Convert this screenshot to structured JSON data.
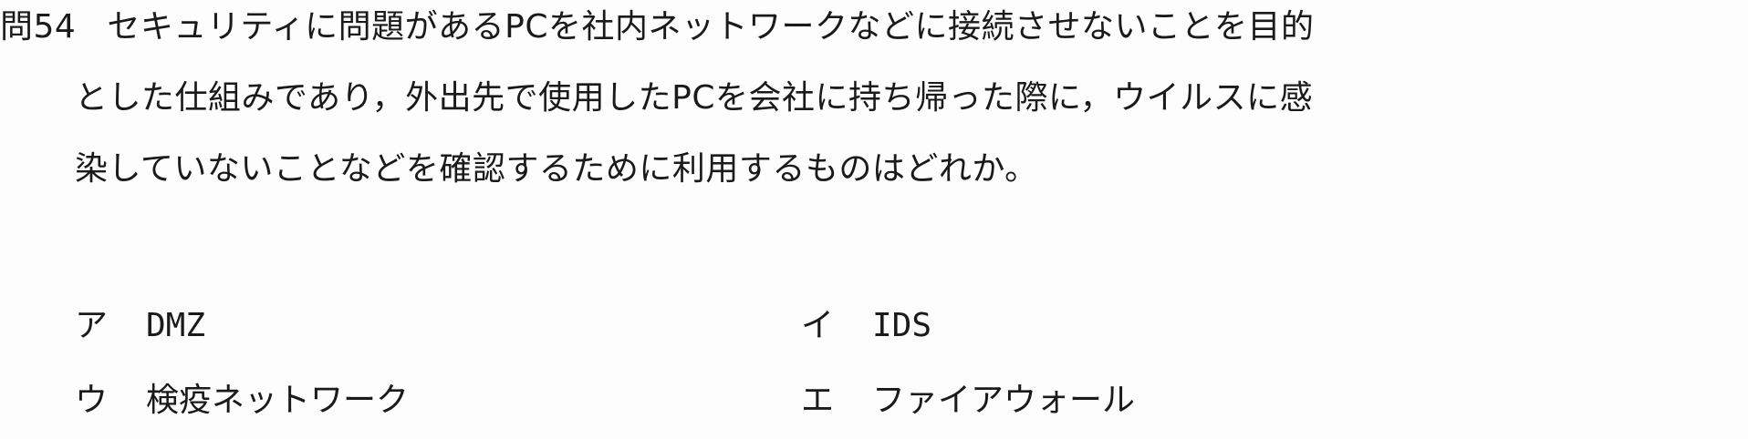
{
  "question": {
    "number": "問54",
    "line1": "セキュリティに問題があるPCを社内ネットワークなどに接続させないことを目的",
    "line2": "とした仕組みであり，外出先で使用したPCを会社に持ち帰った際に，ウイルスに感",
    "line3": "染していないことなどを確認するために利用するものはどれか。"
  },
  "choices": [
    {
      "marker": "ア",
      "text": "DMZ"
    },
    {
      "marker": "イ",
      "text": "IDS"
    },
    {
      "marker": "ウ",
      "text": "検疫ネットワーク"
    },
    {
      "marker": "エ",
      "text": "ファイアウォール"
    }
  ]
}
